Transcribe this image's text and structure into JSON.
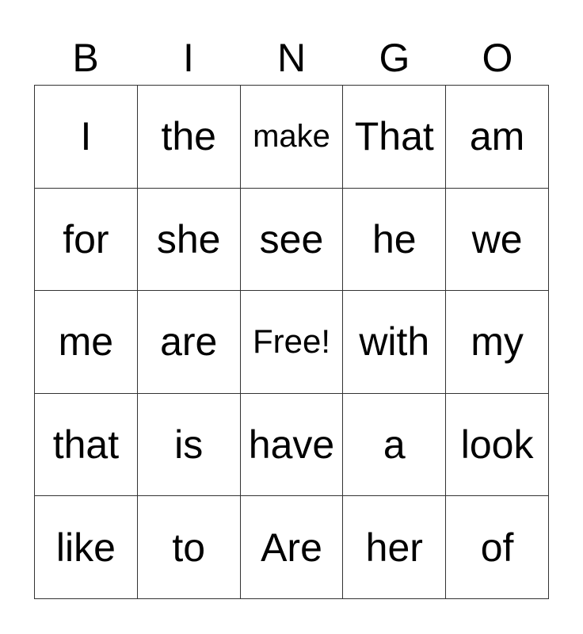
{
  "header": [
    "B",
    "I",
    "N",
    "G",
    "O"
  ],
  "rows": [
    [
      "I",
      "the",
      "make",
      "That",
      "am"
    ],
    [
      "for",
      "she",
      "see",
      "he",
      "we"
    ],
    [
      "me",
      "are",
      "Free!",
      "with",
      "my"
    ],
    [
      "that",
      "is",
      "have",
      "a",
      "look"
    ],
    [
      "like",
      "to",
      "Are",
      "her",
      "of"
    ]
  ]
}
